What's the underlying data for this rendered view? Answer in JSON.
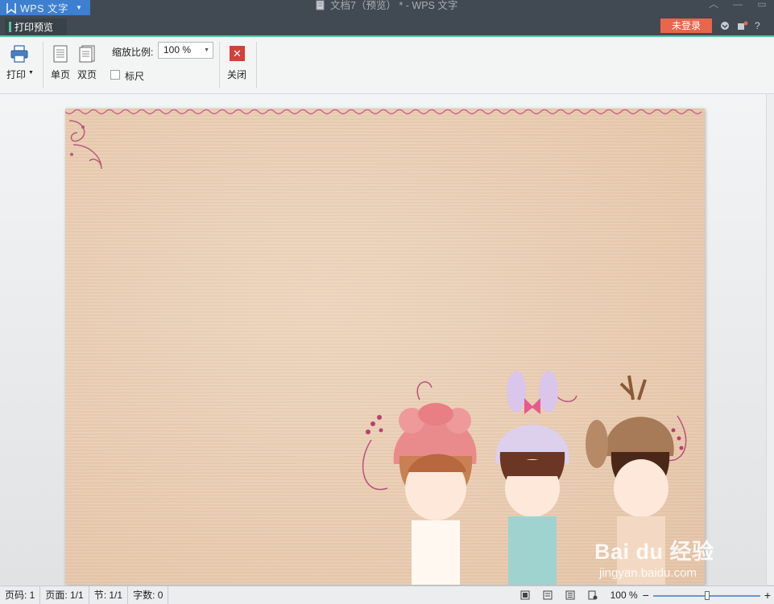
{
  "titlebar": {
    "app_name": "WPS 文字",
    "window_title": "文档7（预览） * - WPS 文字"
  },
  "tabbar": {
    "active_tab": "打印预览",
    "login_label": "未登录",
    "help_label": "?"
  },
  "ribbon": {
    "print_label": "打印",
    "single_page_label": "单页",
    "double_page_label": "双页",
    "zoom_label": "缩放比例:",
    "zoom_value": "100 %",
    "ruler_label": "标尺",
    "ruler_checked": false,
    "close_label": "关闭"
  },
  "watermark": {
    "main": "Bai du 经验",
    "sub": "jingyan.baidu.com"
  },
  "statusbar": {
    "page_code": "页码: 1",
    "page_count": "页面: 1/1",
    "section": "节: 1/1",
    "word_count": "字数: 0",
    "zoom_percent": "100 %",
    "zoom_level": 0.5
  },
  "colors": {
    "accent_green": "#56c6a6",
    "login_orange": "#e7664c",
    "app_blue": "#3d7fd0",
    "close_red": "#d2413b",
    "page_bg": "#ebd0b5"
  }
}
